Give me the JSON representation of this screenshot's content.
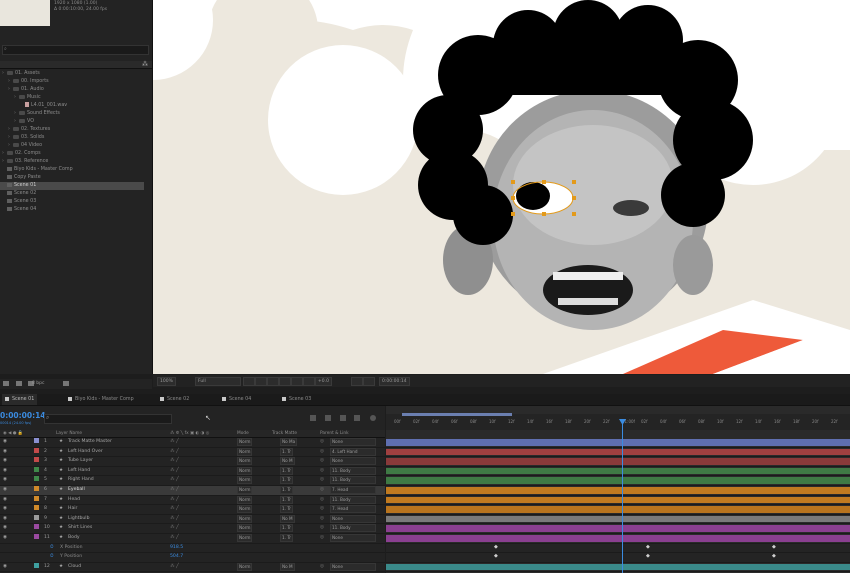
{
  "project_panel": {
    "meta_line1": "1920 x 1080 (1.00)",
    "meta_line2": "Δ 0:00:10:00, 24.00 fps",
    "items": [
      {
        "label": "01. Assets",
        "level": 0,
        "kind": "folder"
      },
      {
        "label": "00. Imports",
        "level": 1,
        "kind": "folder"
      },
      {
        "label": "01. Audio",
        "level": 1,
        "kind": "folder"
      },
      {
        "label": "Music",
        "level": 2,
        "kind": "folder"
      },
      {
        "label": "L4.01_001.wav",
        "level": 3,
        "kind": "audio"
      },
      {
        "label": "Sound Effects",
        "level": 2,
        "kind": "folder"
      },
      {
        "label": "VO",
        "level": 2,
        "kind": "folder"
      },
      {
        "label": "02. Textures",
        "level": 1,
        "kind": "folder"
      },
      {
        "label": "03. Solids",
        "level": 1,
        "kind": "folder"
      },
      {
        "label": "04 Video",
        "level": 1,
        "kind": "folder"
      },
      {
        "label": "02. Comps",
        "level": 0,
        "kind": "folder"
      },
      {
        "label": "03. Reference",
        "level": 0,
        "kind": "folder"
      },
      {
        "label": "Biyo Kids - Master Comp",
        "level": 0,
        "kind": "comp"
      },
      {
        "label": "Copy Paste",
        "level": 0,
        "kind": "comp"
      },
      {
        "label": "Scene 01",
        "level": 0,
        "kind": "comp",
        "selected": true
      },
      {
        "label": "Scene 02",
        "level": 0,
        "kind": "comp"
      },
      {
        "label": "Scene 03",
        "level": 0,
        "kind": "comp"
      },
      {
        "label": "Scene 04",
        "level": 0,
        "kind": "comp"
      }
    ],
    "footer_bpc": "8 bpc"
  },
  "viewer_bar": {
    "zoom": "100%",
    "resolution": "Full",
    "exposure": "+0.0",
    "timecode": "0:00:00:14"
  },
  "tabs": [
    {
      "label": "Scene 01",
      "active": true
    },
    {
      "label": "Biyo Kids - Master Comp"
    },
    {
      "label": "Scene 02"
    },
    {
      "label": "Scene 04"
    },
    {
      "label": "Scene 03"
    }
  ],
  "timeline": {
    "timecode": "0:00:00:14",
    "timecode_sub": "00014 (24.00 fps)",
    "columns": {
      "layer_name": "Layer Name",
      "mode": "Mode",
      "track_matte": "Track Matte",
      "parent": "Parent & Link"
    },
    "ruler_ticks": [
      "00f",
      "02f",
      "04f",
      "06f",
      "08f",
      "10f",
      "12f",
      "14f",
      "16f",
      "18f",
      "20f",
      "22f",
      "01:00f",
      "02f",
      "04f",
      "06f",
      "08f",
      "10f",
      "12f",
      "14f",
      "16f",
      "18f",
      "20f",
      "22f"
    ],
    "layers": [
      {
        "num": "1",
        "name": "Track Matte Master",
        "color": "#8a8fd0",
        "mode": "Norm",
        "matte": "No Ma",
        "parent": "None",
        "track": "#5f6fb0"
      },
      {
        "num": "2",
        "name": "Left Hand Over",
        "color": "#c34a4a",
        "mode": "Norm",
        "matte": "1. Tr",
        "parent": "4. Left Hand",
        "track": "#a04040"
      },
      {
        "num": "3",
        "name": "Tube Layer",
        "color": "#c34a4a",
        "mode": "Norm",
        "matte": "No M",
        "parent": "None",
        "track": "#8a3a3a"
      },
      {
        "num": "4",
        "name": "Left Hand",
        "color": "#3f8a4a",
        "mode": "Norm",
        "matte": "1. Tr",
        "parent": "11. Body",
        "track": "#3f7a45"
      },
      {
        "num": "5",
        "name": "Right Hand",
        "color": "#3f8a4a",
        "mode": "Norm",
        "matte": "1. Tr",
        "parent": "11. Body",
        "track": "#3f7a45"
      },
      {
        "num": "6",
        "name": "Eyeball",
        "color": "#d08a2a",
        "mode": "Norm",
        "matte": "1. Tr",
        "parent": "7. Head",
        "track": "#c07a20",
        "selected": true
      },
      {
        "num": "7",
        "name": "Head",
        "color": "#d08a2a",
        "mode": "Norm",
        "matte": "1. Tr",
        "parent": "11. Body",
        "track": "#c07a20"
      },
      {
        "num": "8",
        "name": "Hair",
        "color": "#d08a2a",
        "mode": "Norm",
        "matte": "1. Tr",
        "parent": "7. Head",
        "track": "#b8741e"
      },
      {
        "num": "9",
        "name": "Lightbulb",
        "color": "#9a9a9a",
        "mode": "Norm",
        "matte": "No M",
        "parent": "None",
        "track": "#7a7a7a"
      },
      {
        "num": "10",
        "name": "Shirt Lines",
        "color": "#9a4aa0",
        "mode": "Norm",
        "matte": "1. Tr",
        "parent": "11. Body",
        "track": "#8a3f90"
      },
      {
        "num": "11",
        "name": "Body",
        "color": "#9a4aa0",
        "mode": "Norm",
        "matte": "1. Tr",
        "parent": "None",
        "track": "#8a3f90"
      }
    ],
    "properties": [
      {
        "name": "X Position",
        "value": "918.5"
      },
      {
        "name": "Y Position",
        "value": "504.7"
      }
    ],
    "last_layer": {
      "num": "12",
      "name": "Cloud",
      "color": "#3fa0a0",
      "mode": "Norm",
      "matte": "No M",
      "parent": "None",
      "track": "#3a8a8a"
    }
  }
}
